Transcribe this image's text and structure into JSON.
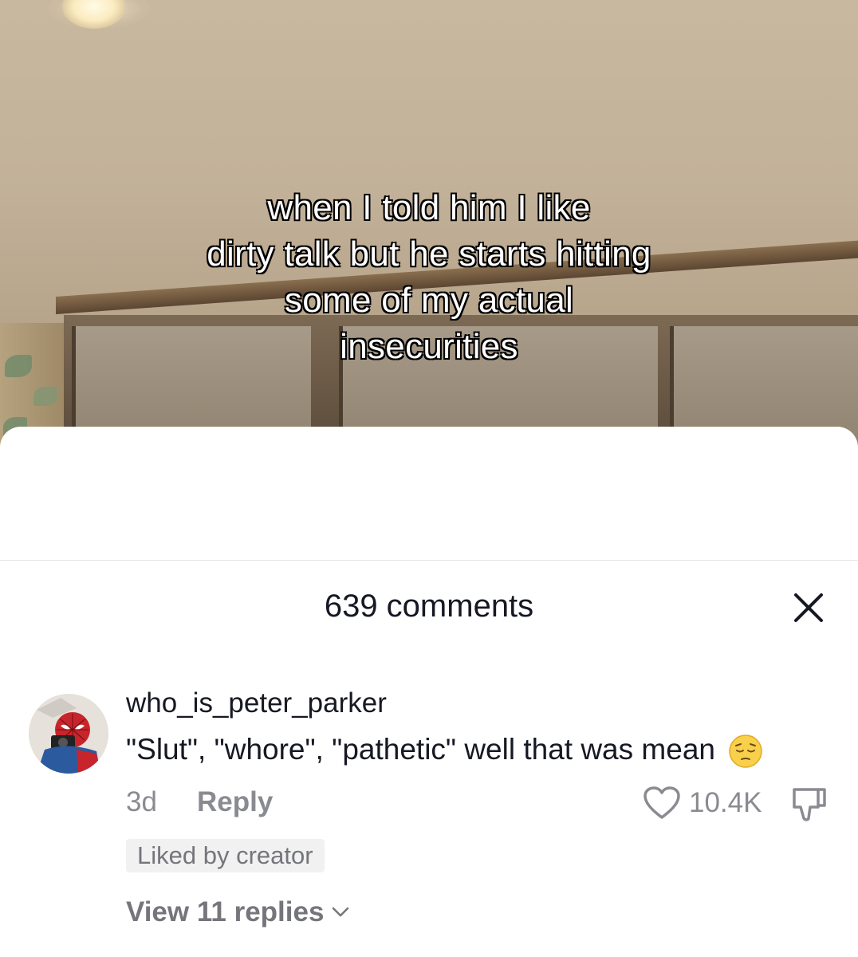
{
  "video": {
    "caption_lines": [
      "when I told him I like",
      "dirty talk but he starts hitting",
      "some of my actual",
      "insecurities"
    ]
  },
  "comments_panel": {
    "title": "639 comments",
    "close_icon": "close-icon"
  },
  "comment": {
    "username": "who_is_peter_parker",
    "text": "\"Slut\", \"whore\", \"pathetic\" well that was mean",
    "emoji": "pensive-face-emoji",
    "time": "3d",
    "reply_label": "Reply",
    "like_count": "10.4K",
    "liked_by_creator_label": "Liked by creator",
    "view_replies_label": "View 11 replies"
  },
  "colors": {
    "primary_text": "#161823",
    "secondary_text": "#8a8b91",
    "badge_bg": "#f1f1f2"
  }
}
